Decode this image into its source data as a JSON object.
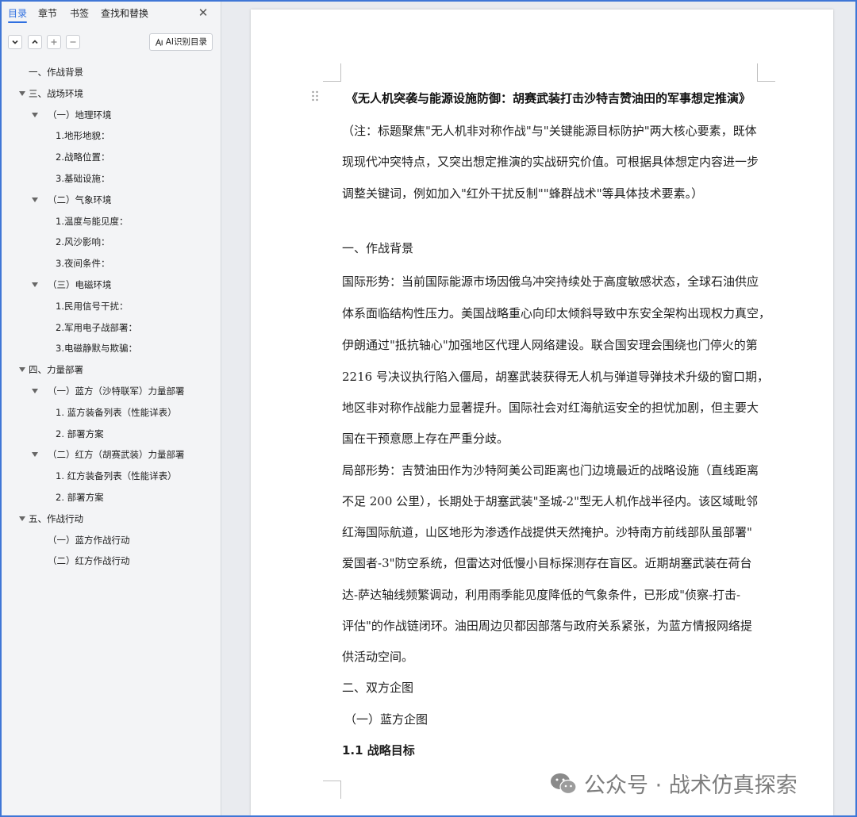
{
  "sidebar": {
    "tabs": [
      "目录",
      "章节",
      "书签",
      "查找和替换"
    ],
    "ai_button_label": "AI识别目录",
    "toc": [
      {
        "label": "一、作战背景",
        "level": 0,
        "caret": false
      },
      {
        "label": "三、战场环境",
        "level": 0,
        "caret": true
      },
      {
        "label": "（一）地理环境",
        "level": 1,
        "caret": true
      },
      {
        "label": "1.地形地貌：",
        "level": 2,
        "caret": false
      },
      {
        "label": "2.战略位置：",
        "level": 2,
        "caret": false
      },
      {
        "label": "3.基础设施：",
        "level": 2,
        "caret": false
      },
      {
        "label": "（二）气象环境",
        "level": 1,
        "caret": true
      },
      {
        "label": "1.温度与能见度：",
        "level": 2,
        "caret": false
      },
      {
        "label": "2.风沙影响：",
        "level": 2,
        "caret": false
      },
      {
        "label": "3.夜间条件：",
        "level": 2,
        "caret": false
      },
      {
        "label": "（三）电磁环境",
        "level": 1,
        "caret": true
      },
      {
        "label": "1.民用信号干扰：",
        "level": 2,
        "caret": false
      },
      {
        "label": "2.军用电子战部署：",
        "level": 2,
        "caret": false
      },
      {
        "label": "3.电磁静默与欺骗：",
        "level": 2,
        "caret": false
      },
      {
        "label": "四、力量部署",
        "level": 0,
        "caret": true
      },
      {
        "label": "（一）蓝方（沙特联军）力量部署",
        "level": 1,
        "caret": true
      },
      {
        "label": "1. 蓝方装备列表（性能详表）",
        "level": 2,
        "caret": false
      },
      {
        "label": "2. 部署方案",
        "level": 2,
        "caret": false
      },
      {
        "label": "（二）红方（胡赛武装）力量部署",
        "level": 1,
        "caret": true
      },
      {
        "label": "1. 红方装备列表（性能详表）",
        "level": 2,
        "caret": false
      },
      {
        "label": "2. 部署方案",
        "level": 2,
        "caret": false
      },
      {
        "label": "五、作战行动",
        "level": 0,
        "caret": true
      },
      {
        "label": "（一）蓝方作战行动",
        "level": 1,
        "caret": false
      },
      {
        "label": "（二）红方作战行动",
        "level": 1,
        "caret": false
      }
    ]
  },
  "document": {
    "lines": [
      {
        "text": "《无人机突袭与能源设施防御：胡赛武装打击沙特吉赞油田的军事想定推演》",
        "style": "title"
      },
      {
        "text": "（注：标题聚焦\"无人机非对称作战\"与\"关键能源目标防护\"两大核心要素，既体",
        "style": "body"
      },
      {
        "text": "现现代冲突特点，又突出想定推演的实战研究价值。可根据具体想定内容进一步",
        "style": "body"
      },
      {
        "text": "调整关键词，例如加入\"红外干扰反制\"\"蜂群战术\"等具体技术要素。）",
        "style": "body"
      },
      {
        "text": "一、作战背景",
        "style": "heading"
      },
      {
        "text": "国际形势：当前国际能源市场因俄乌冲突持续处于高度敏感状态，全球石油供应",
        "style": "body"
      },
      {
        "text": "体系面临结构性压力。美国战略重心向印太倾斜导致中东安全架构出现权力真空，",
        "style": "body"
      },
      {
        "text": "伊朗通过\"抵抗轴心\"加强地区代理人网络建设。联合国安理会围绕也门停火的第",
        "style": "body"
      },
      {
        "text": "2216 号决议执行陷入僵局，胡塞武装获得无人机与弹道导弹技术升级的窗口期，",
        "style": "body"
      },
      {
        "text": "地区非对称作战能力显著提升。国际社会对红海航运安全的担忧加剧，但主要大",
        "style": "body"
      },
      {
        "text": "国在干预意愿上存在严重分歧。",
        "style": "body"
      },
      {
        "text": "局部形势：吉赞油田作为沙特阿美公司距离也门边境最近的战略设施（直线距离",
        "style": "body"
      },
      {
        "text": "不足 200 公里），长期处于胡塞武装\"圣城-2\"型无人机作战半径内。该区域毗邻",
        "style": "body"
      },
      {
        "text": "红海国际航道，山区地形为渗透作战提供天然掩护。沙特南方前线部队虽部署\"",
        "style": "body"
      },
      {
        "text": "爱国者-3\"防空系统，但雷达对低慢小目标探测存在盲区。近期胡塞武装在荷台",
        "style": "body"
      },
      {
        "text": "达-萨达轴线频繁调动，利用雨季能见度降低的气象条件，已形成\"侦察-打击-",
        "style": "body"
      },
      {
        "text": "评估\"的作战链闭环。油田周边贝都因部落与政府关系紧张，为蓝方情报网络提",
        "style": "body"
      },
      {
        "text": "供活动空间。",
        "style": "body"
      },
      {
        "text": "二、双方企图",
        "style": "heading"
      },
      {
        "text": "（一）蓝方企图",
        "style": "heading"
      },
      {
        "text": "1.1  战略目标",
        "style": "heading-bold"
      }
    ]
  },
  "watermark": {
    "text": "公众号 · 战术仿真探索",
    "icon": "wechat-icon"
  }
}
